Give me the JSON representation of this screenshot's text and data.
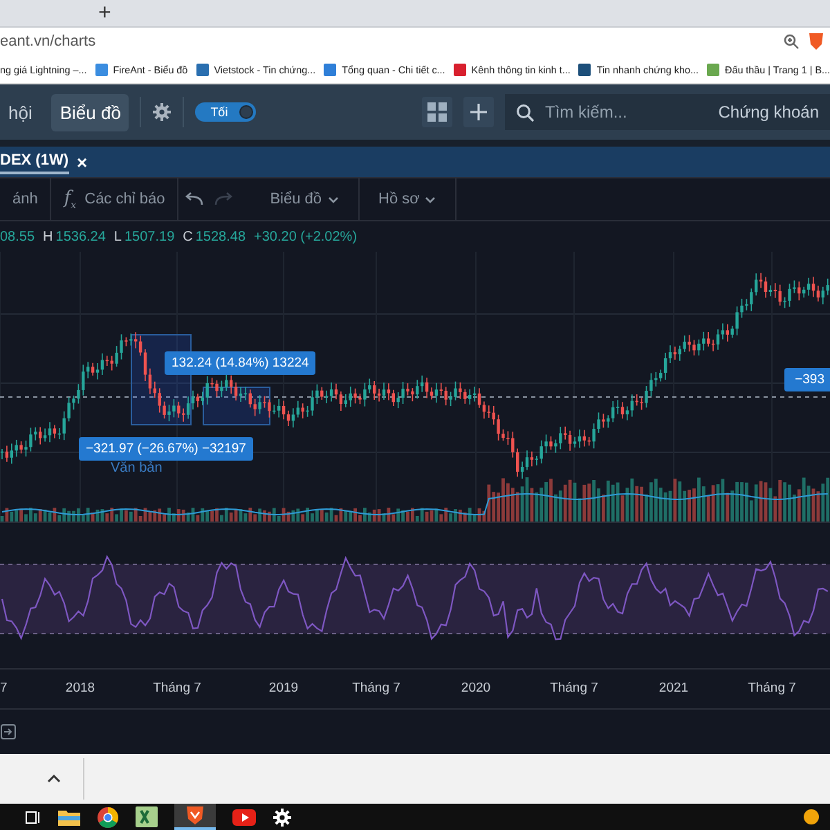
{
  "browser": {
    "new_tab": "+",
    "address": "eant.vn/charts",
    "bookmarks": [
      {
        "label": "ng giá Lightning –..."
      },
      {
        "label": "FireAnt - Biểu đồ",
        "color": "#3b8de0"
      },
      {
        "label": "Vietstock - Tin chứng...",
        "color": "#2a6fb0"
      },
      {
        "label": "Tổng quan - Chi tiết c...",
        "color": "#2f7fd8"
      },
      {
        "label": "Kênh thông tin kinh t...",
        "color": "#d8202e"
      },
      {
        "label": "Tin nhanh chứng kho...",
        "color": "#1d4f7a"
      },
      {
        "label": "Đấu thầu | Trang 1 | B...",
        "color": "#6aa84f"
      }
    ]
  },
  "app_header": {
    "nav": [
      {
        "label": "hội",
        "selected": false
      },
      {
        "label": "Biểu đồ",
        "selected": true
      }
    ],
    "theme_toggle": {
      "label": "Tối",
      "on": true
    },
    "search": {
      "placeholder": "Tìm kiếm..."
    },
    "market_label": "Chứng khoán"
  },
  "chart_tab": {
    "title": "DEX (1W)",
    "close": "×"
  },
  "toolbar": [
    {
      "kind": "text",
      "label": "ánh"
    },
    {
      "kind": "indicators",
      "icon": "f$_{x}$",
      "label": "Các chỉ báo"
    },
    {
      "kind": "undo"
    },
    {
      "kind": "redo"
    },
    {
      "kind": "menu",
      "label": "Biểu đồ"
    },
    {
      "kind": "menu",
      "label": "Hồ sơ"
    }
  ],
  "ohlc": [
    {
      "value": "08.55"
    },
    {
      "letter": "H",
      "value": "1536.24"
    },
    {
      "letter": "L",
      "value": "1507.19"
    },
    {
      "letter": "C",
      "value": "1528.48"
    }
  ],
  "change": "+30.20 (+2.02%)",
  "measurements": [
    {
      "text": "132.24 (14.84%) 13224"
    },
    {
      "text": "−321.97 (−26.67%) −32197"
    }
  ],
  "text_note": "Văn bản",
  "price_tag": "−393",
  "x_axis": [
    "7",
    "2018",
    "Tháng 7",
    "2019",
    "Tháng 7",
    "2020",
    "Tháng 7",
    "2021",
    "Tháng 7"
  ]
}
